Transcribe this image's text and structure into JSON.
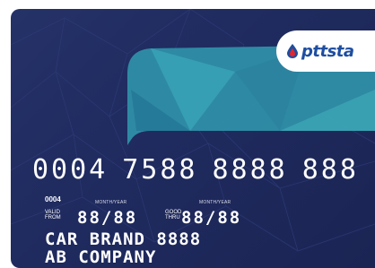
{
  "brand": {
    "logo_text": "pttsta",
    "colors": {
      "card_background": "#232d62",
      "logo_blue": "#1e4ea0",
      "logo_red": "#e2262f",
      "banner_teal": "#3aa3b6"
    }
  },
  "card": {
    "number_groups": [
      "0004",
      "7588",
      "8888",
      "888"
    ],
    "small_code": "0004",
    "month_year_label_1": "MONTH/YEAR",
    "month_year_label_2": "MONTH/YEAR",
    "valid_from_line1": "VALID",
    "valid_from_line2": "FROM",
    "good_thru_line1": "GOOD",
    "good_thru_line2": "THRU",
    "valid_from_value": "88/88",
    "good_thru_value": "88/88",
    "holder_name": "CAR BRAND 8888",
    "company": "AB COMPANY"
  }
}
